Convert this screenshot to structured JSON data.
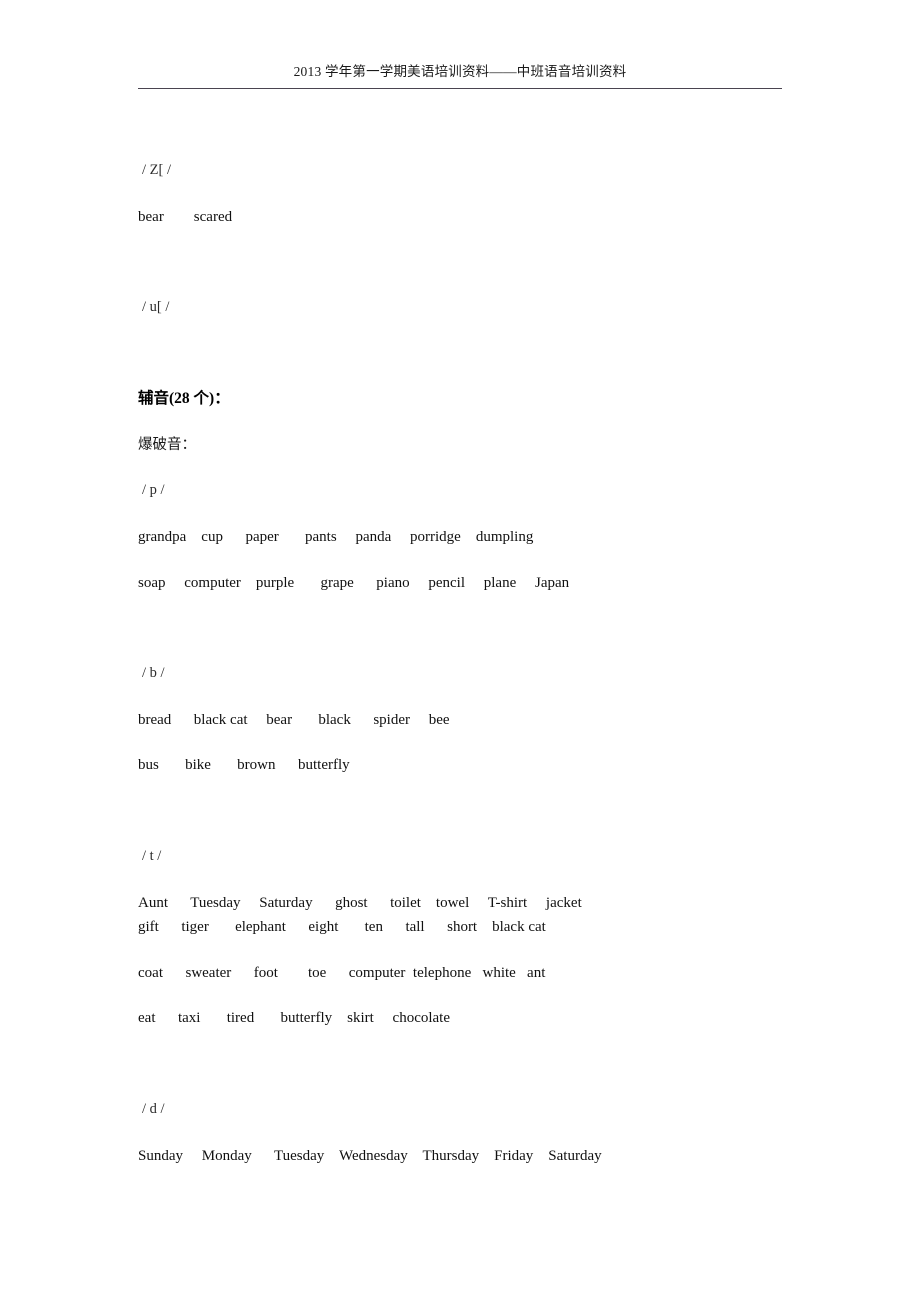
{
  "document": {
    "header_text": "2013 学年第一学期美语培训资料——中班语音培训资料"
  },
  "vowel_section": {
    "symbol_1": "/ Z[ /",
    "symbol_1_words": "bear        scared",
    "symbol_2": "/ u[ /"
  },
  "consonant_section": {
    "title": "辅音(28 个)：",
    "subtitle": "爆破音："
  },
  "groups": [
    {
      "symbol": "/ p /",
      "lines": [
        "grandpa    cup      paper       pants     panda     porridge    dumpling",
        "soap     computer    purple       grape      piano     pencil     plane     Japan"
      ]
    },
    {
      "symbol": "/ b /",
      "lines": [
        "bread      black cat     bear       black      spider     bee",
        "bus       bike       brown      butterfly"
      ]
    },
    {
      "symbol": "/ t /",
      "lines": [
        "Aunt      Tuesday     Saturday      ghost      toilet    towel     T-shirt     jacket",
        "gift      tiger       elephant      eight       ten      tall      short    black cat",
        "coat      sweater      foot        toe      computer  telephone   white   ant",
        "eat      taxi       tired       butterfly    skirt     chocolate"
      ]
    },
    {
      "symbol": "/ d /",
      "lines": [
        "Sunday     Monday      Tuesday    Wednesday    Thursday    Friday    Saturday"
      ]
    }
  ]
}
